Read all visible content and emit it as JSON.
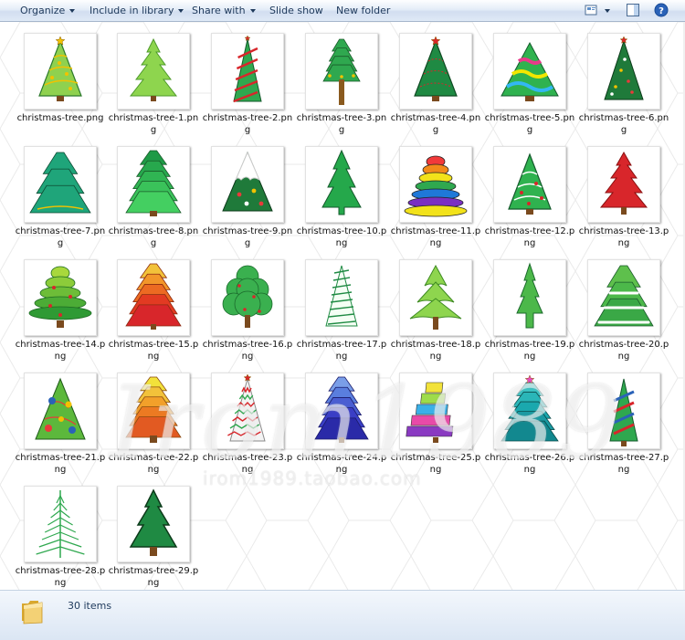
{
  "toolbar": {
    "organize": "Organize",
    "include_in_library": "Include in library",
    "share_with": "Share with",
    "slide_show": "Slide show",
    "new_folder": "New folder",
    "icons": [
      "view-icon",
      "preview-pane-icon",
      "help-icon"
    ]
  },
  "files": [
    {
      "name": "christmas-tree.png",
      "style": "star-lime"
    },
    {
      "name": "christmas-tree-1.png",
      "style": "light-spiky"
    },
    {
      "name": "christmas-tree-2.png",
      "style": "stripe-cone"
    },
    {
      "name": "christmas-tree-3.png",
      "style": "tall-trunk"
    },
    {
      "name": "christmas-tree-4.png",
      "style": "star-lights"
    },
    {
      "name": "christmas-tree-5.png",
      "style": "wavy-bands"
    },
    {
      "name": "christmas-tree-6.png",
      "style": "dark-cone"
    },
    {
      "name": "christmas-tree-7.png",
      "style": "tiered-teal"
    },
    {
      "name": "christmas-tree-8.png",
      "style": "tiered-stack"
    },
    {
      "name": "christmas-tree-9.png",
      "style": "snow-cap"
    },
    {
      "name": "christmas-tree-10.png",
      "style": "flat-green"
    },
    {
      "name": "christmas-tree-11.png",
      "style": "rainbow-stack"
    },
    {
      "name": "christmas-tree-12.png",
      "style": "garland"
    },
    {
      "name": "christmas-tree-13.png",
      "style": "red-spiky"
    },
    {
      "name": "christmas-tree-14.png",
      "style": "round-tiers"
    },
    {
      "name": "christmas-tree-15.png",
      "style": "orange-tiers"
    },
    {
      "name": "christmas-tree-16.png",
      "style": "bushy"
    },
    {
      "name": "christmas-tree-17.png",
      "style": "sketch"
    },
    {
      "name": "christmas-tree-18.png",
      "style": "drip-tiers"
    },
    {
      "name": "christmas-tree-19.png",
      "style": "thin-pine"
    },
    {
      "name": "christmas-tree-20.png",
      "style": "snow-tiers"
    },
    {
      "name": "christmas-tree-21.png",
      "style": "ornaments"
    },
    {
      "name": "christmas-tree-22.png",
      "style": "yellow-tiers"
    },
    {
      "name": "christmas-tree-23.png",
      "style": "zigzag"
    },
    {
      "name": "christmas-tree-24.png",
      "style": "blue-tiers"
    },
    {
      "name": "christmas-tree-25.png",
      "style": "block-tiers"
    },
    {
      "name": "christmas-tree-26.png",
      "style": "aqua-star"
    },
    {
      "name": "christmas-tree-27.png",
      "style": "stripe-blue"
    },
    {
      "name": "christmas-tree-28.png",
      "style": "fern"
    },
    {
      "name": "christmas-tree-29.png",
      "style": "plain-pine"
    }
  ],
  "status": {
    "count_text": "30 items"
  },
  "watermark": {
    "big": "Irom1989",
    "small": "irom1989.taobao.com"
  },
  "colors": {
    "accent": "#1e395b",
    "dark_green": "#1f7a3a",
    "green": "#2fa84f",
    "lime": "#8fd14f",
    "red": "#d8262b",
    "gold": "#f2c200"
  }
}
